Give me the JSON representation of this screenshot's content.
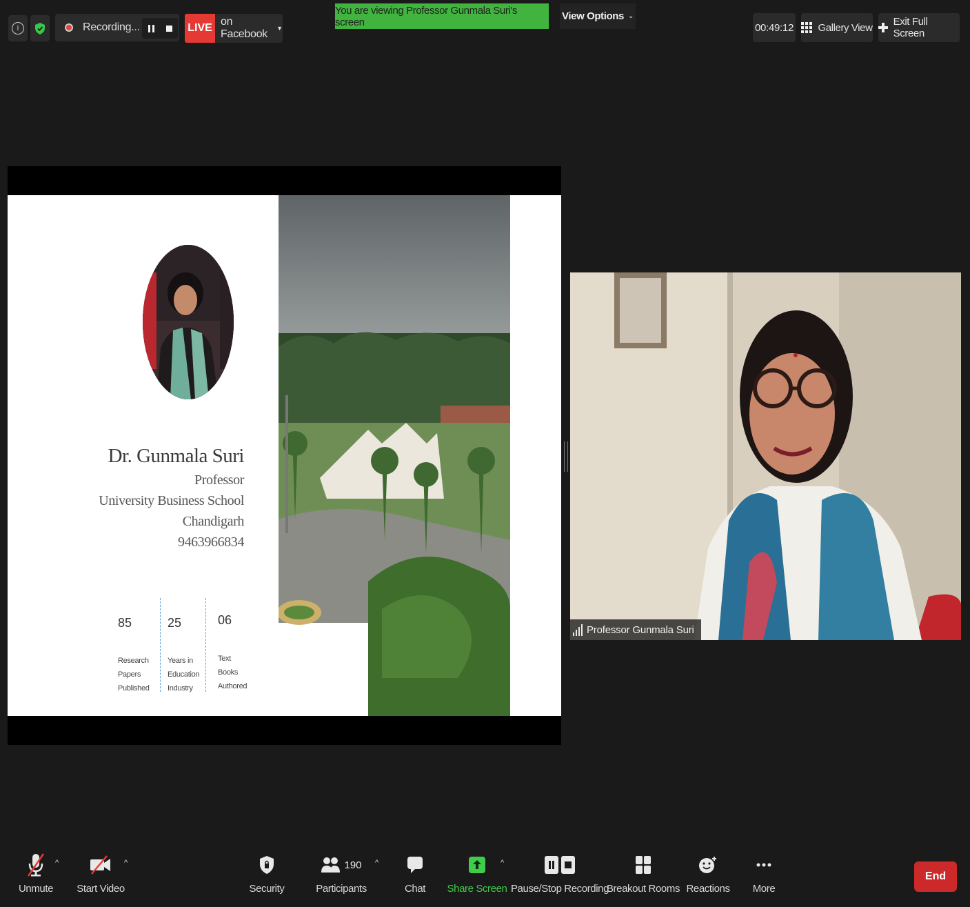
{
  "top_bar": {
    "recording_label": "Recording...",
    "live_label": "LIVE",
    "stream_target": "on Facebook",
    "viewing_banner": "You are viewing Professor Gunmala Suri's screen",
    "view_options_label": "View Options",
    "timer": "00:49:12",
    "gallery_view_label": "Gallery View",
    "exit_full_screen_label": "Exit Full Screen"
  },
  "slide": {
    "name": "Dr. Gunmala Suri",
    "title": "Professor",
    "institution": "University Business School",
    "city": "Chandigarh",
    "phone": "9463966834",
    "stats": [
      {
        "value": "85",
        "caption_lines": [
          "Research",
          "Papers",
          "Published"
        ]
      },
      {
        "value": "25",
        "caption_lines": [
          "Years in",
          "Education",
          "Industry"
        ]
      },
      {
        "value": "06",
        "caption_lines": [
          "Text",
          "Books",
          "Authored"
        ]
      }
    ]
  },
  "participant": {
    "name": "Professor Gunmala Suri"
  },
  "toolbar": {
    "unmute": "Unmute",
    "start_video": "Start Video",
    "security": "Security",
    "participants": "Participants",
    "participants_count": "190",
    "chat": "Chat",
    "share_screen": "Share Screen",
    "pause_stop_recording": "Pause/Stop Recording",
    "breakout_rooms": "Breakout Rooms",
    "reactions": "Reactions",
    "more": "More",
    "end": "End"
  },
  "colors": {
    "live_red": "#e53935",
    "banner_green": "#41b43f",
    "share_green": "#3fcc4a",
    "end_red": "#cc2a2a",
    "background": "#1a1a1a"
  }
}
